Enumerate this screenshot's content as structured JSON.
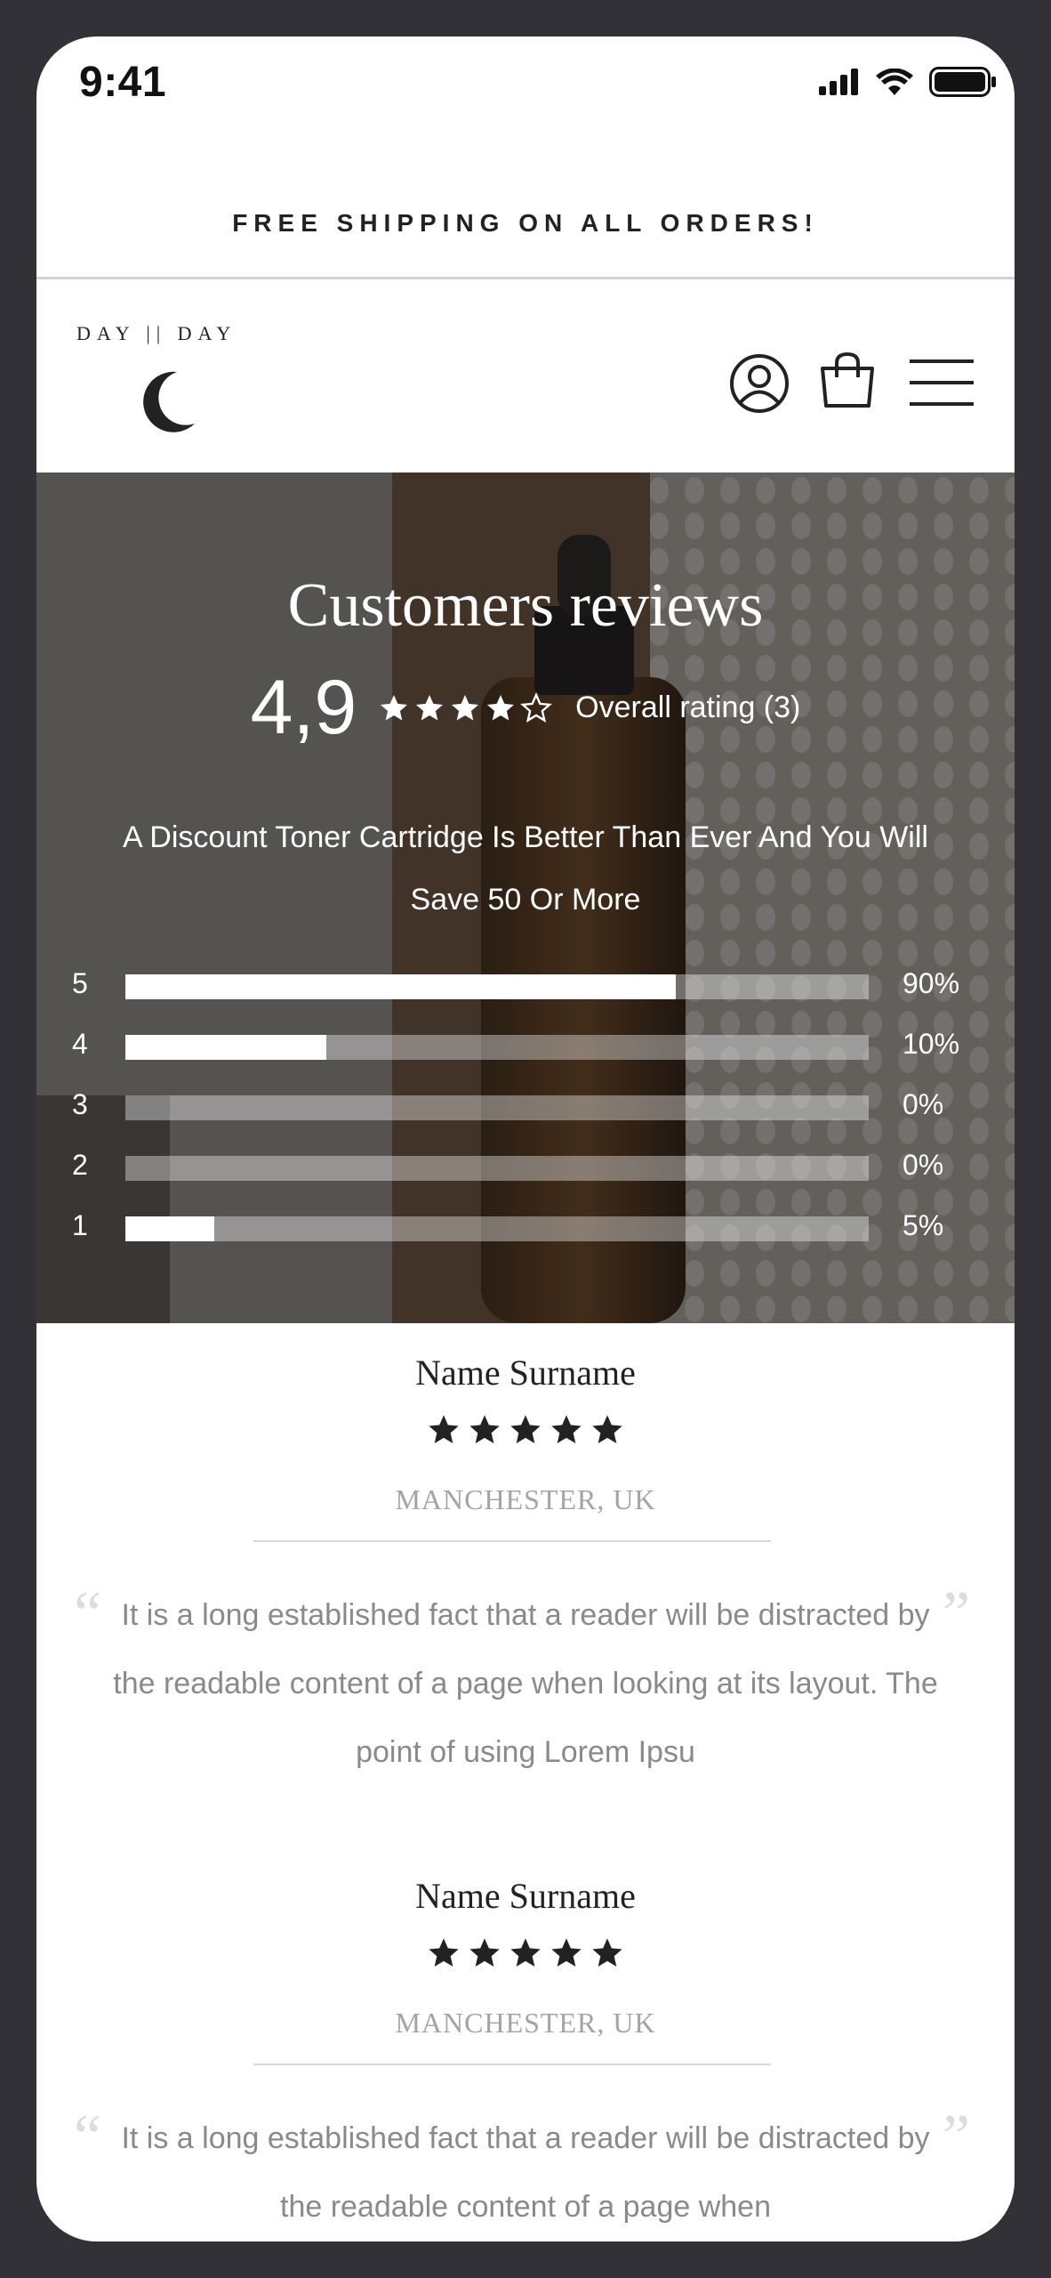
{
  "status_bar": {
    "time": "9:41",
    "icons": [
      "signal-icon",
      "wifi-icon",
      "battery-icon"
    ]
  },
  "promo": {
    "text": "FREE SHIPPING ON ALL ORDERS!"
  },
  "header": {
    "logo_text": "DAY || DAY",
    "icons": [
      "account-icon",
      "shopping-bag-icon",
      "menu-icon"
    ]
  },
  "hero": {
    "title": "Customers reviews",
    "rating_value": "4,9",
    "rating_stars": 4,
    "rating_label": "Overall rating (3)",
    "subtitle": "A Discount Toner Cartridge Is Better Than Ever And You Will Save 50 Or More",
    "bars": [
      {
        "label": "5",
        "percent_text": "90%",
        "fill": 0.74
      },
      {
        "label": "4",
        "percent_text": "10%",
        "fill": 0.27
      },
      {
        "label": "3",
        "percent_text": "0%",
        "fill": 0
      },
      {
        "label": "2",
        "percent_text": "0%",
        "fill": 0
      },
      {
        "label": "1",
        "percent_text": "5%",
        "fill": 0.12
      }
    ]
  },
  "reviews": [
    {
      "name": "Name Surname",
      "stars": 5,
      "location": "MANCHESTER, UK",
      "text": "It is a long established fact that a reader will be distracted by the readable content of a page when looking at its layout. The point of using Lorem Ipsu"
    },
    {
      "name": "Name Surname",
      "stars": 5,
      "location": "MANCHESTER, UK",
      "text": "It is a long established fact that a reader will be distracted by the readable content of a page when"
    }
  ],
  "colors": {
    "frame": "#323137",
    "text_dark": "#222222",
    "muted": "#8a8a8a",
    "star": "#222222"
  }
}
